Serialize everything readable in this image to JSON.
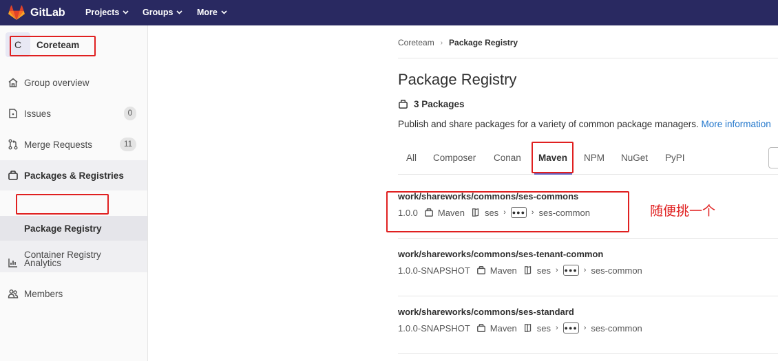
{
  "topbar": {
    "logo_text": "GitLab",
    "nav": [
      {
        "label": "Projects"
      },
      {
        "label": "Groups"
      },
      {
        "label": "More"
      }
    ],
    "bg_color": "#292961"
  },
  "sidebar": {
    "context": {
      "avatar_letter": "C",
      "name": "Coreteam"
    },
    "items": [
      {
        "label": "Group overview",
        "icon": "home-icon"
      },
      {
        "label": "Issues",
        "icon": "issues-icon",
        "badge": "0"
      },
      {
        "label": "Merge Requests",
        "icon": "merge-request-icon",
        "badge": "11"
      },
      {
        "label": "Packages & Registries",
        "icon": "package-icon",
        "active": true
      },
      {
        "label": "Analytics",
        "icon": "chart-icon"
      },
      {
        "label": "Members",
        "icon": "users-icon"
      }
    ],
    "subitems": [
      {
        "label": "Package Registry",
        "current": true
      },
      {
        "label": "Container Registry"
      }
    ]
  },
  "breadcrumb": {
    "parent": "Coreteam",
    "current": "Package Registry"
  },
  "page": {
    "title": "Package Registry",
    "count_label": "3 Packages",
    "description": "Publish and share packages for a variety of common package managers.",
    "more_link": "More information"
  },
  "tabs": [
    {
      "label": "All"
    },
    {
      "label": "Composer"
    },
    {
      "label": "Conan"
    },
    {
      "label": "Maven",
      "active": true
    },
    {
      "label": "NPM"
    },
    {
      "label": "NuGet"
    },
    {
      "label": "PyPI"
    }
  ],
  "packages": [
    {
      "name": "work/shareworks/commons/ses-commons",
      "version": "1.0.0",
      "type": "Maven",
      "project": "ses",
      "path_end": "ses-common"
    },
    {
      "name": "work/shareworks/commons/ses-tenant-common",
      "version": "1.0.0-SNAPSHOT",
      "type": "Maven",
      "project": "ses",
      "path_end": "ses-common"
    },
    {
      "name": "work/shareworks/commons/ses-standard",
      "version": "1.0.0-SNAPSHOT",
      "type": "Maven",
      "project": "ses",
      "path_end": "ses-common"
    }
  ],
  "annotation": {
    "text": "随便挑一个",
    "color": "#e02020"
  }
}
